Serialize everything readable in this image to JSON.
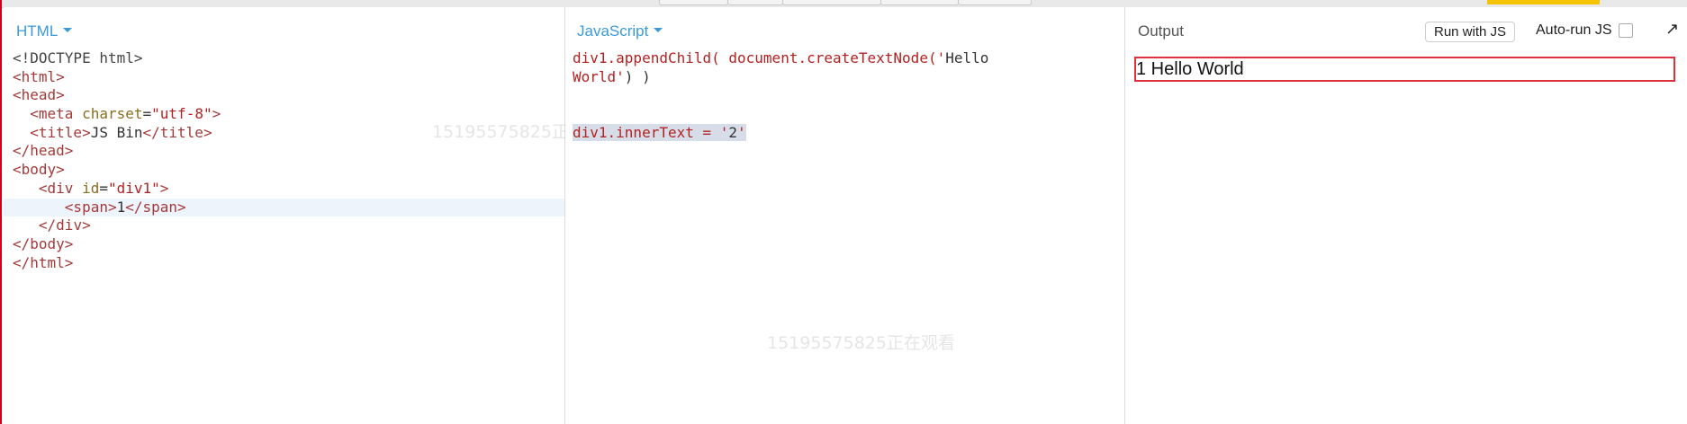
{
  "panels": {
    "html": {
      "title": "HTML",
      "lines": [
        "<!DOCTYPE html>",
        "<html>",
        "<head>",
        "  <meta charset=\"utf-8\">",
        "  <title>JS Bin</title>",
        "</head>",
        "<body>",
        "   <div id=\"div1\">",
        "      <span>1</span>",
        "   </div>",
        "</body>",
        "</html>"
      ],
      "active_line": 8
    },
    "js": {
      "title": "JavaScript",
      "lines": [
        "div1.appendChild( document.createTextNode('Hello",
        "World') )",
        "",
        "",
        "div1.innerText = '2'"
      ]
    },
    "output": {
      "title": "Output",
      "run_button": "Run with JS",
      "autorun_label": "Auto-run JS",
      "autorun_checked": false,
      "popout_icon": "popout-arrow-icon",
      "rendered_text": "1 Hello World"
    }
  },
  "watermarks": [
    "15195575825正在观看",
    "15195575825正在观看"
  ],
  "colors": {
    "accent": "#3b9ad9",
    "output_border": "#e0303b",
    "frame_border": "#d0021b"
  }
}
